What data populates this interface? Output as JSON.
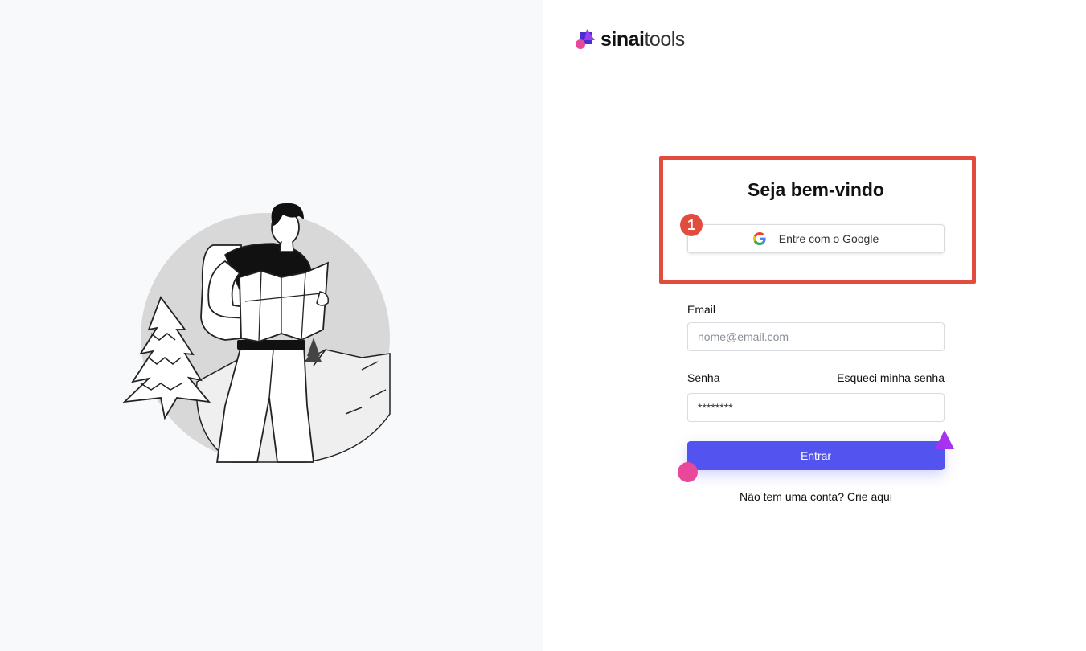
{
  "brand": {
    "name_bold": "sinai",
    "name_light": "tools",
    "colors": {
      "pink": "#e8479a",
      "indigo": "#4a2fd0",
      "purple": "#9b3df0"
    }
  },
  "illustration": {
    "icon": "hiker-with-map-illustration"
  },
  "login": {
    "title": "Seja bem-vindo",
    "step_badge": "1",
    "google_button_label": "Entre com o Google",
    "email_label": "Email",
    "email_placeholder": "nome@email.com",
    "password_label": "Senha",
    "forgot_password": "Esqueci minha senha",
    "password_value": "********",
    "submit_label": "Entrar",
    "signup_prompt": "Não tem uma conta?",
    "signup_link": "Crie aqui"
  },
  "colors": {
    "accent": "#5354f0",
    "highlight": "#e24c3f",
    "left_background": "#f8f9fb"
  }
}
